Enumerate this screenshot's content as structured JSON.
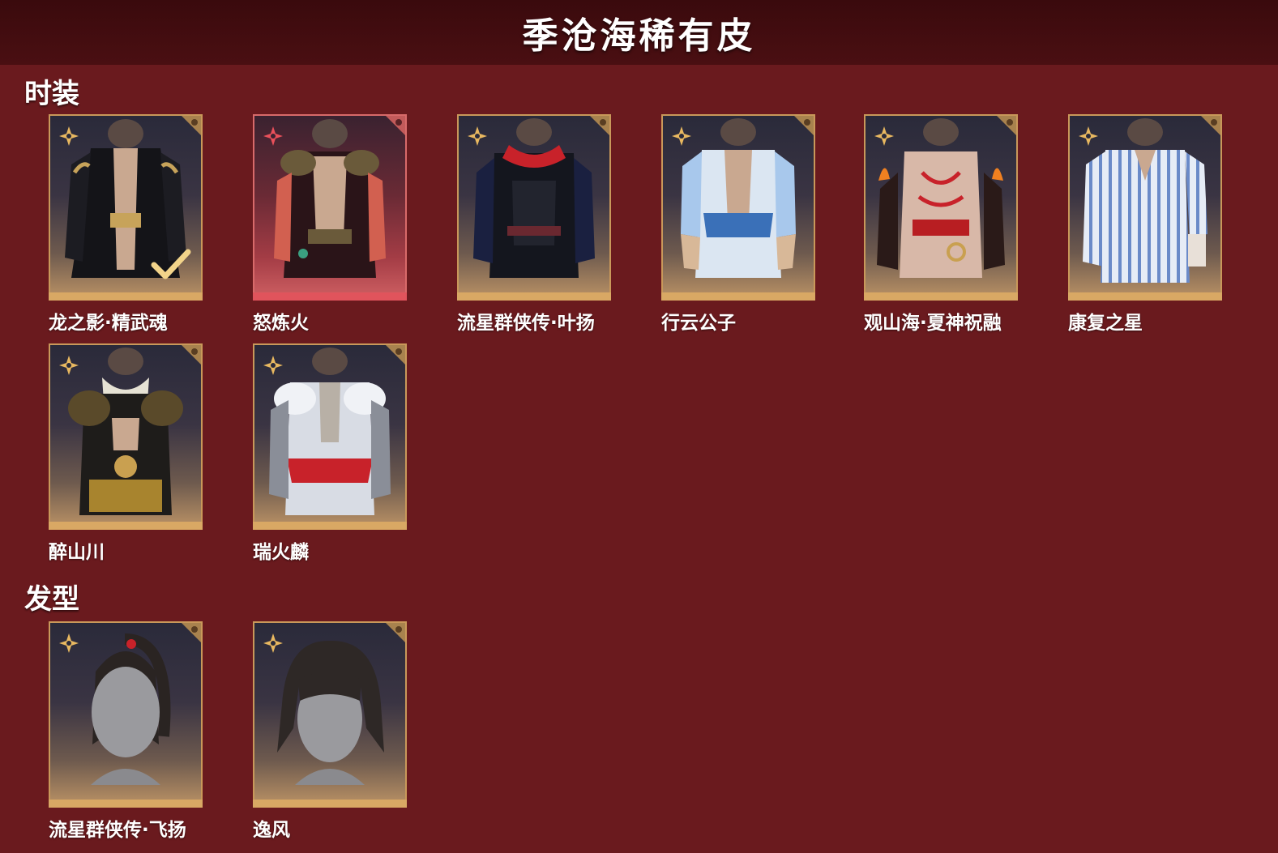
{
  "header": {
    "title": "季沧海稀有皮"
  },
  "sections": {
    "outfits": {
      "title": "时装",
      "items": [
        {
          "name": "龙之影·精武魂",
          "icon": "outfit-black-robe-icon",
          "tier": "gold",
          "selected": true
        },
        {
          "name": "怒炼火",
          "icon": "outfit-fire-armor-icon",
          "tier": "red",
          "selected": false
        },
        {
          "name": "流星群侠传·叶扬",
          "icon": "outfit-dark-scarf-icon",
          "tier": "gold",
          "selected": false
        },
        {
          "name": "行云公子",
          "icon": "outfit-blue-silk-icon",
          "tier": "gold",
          "selected": false
        },
        {
          "name": "观山海·夏神祝融",
          "icon": "outfit-tattoo-flame-icon",
          "tier": "gold",
          "selected": false
        },
        {
          "name": "康复之星",
          "icon": "outfit-striped-pajama-icon",
          "tier": "gold",
          "selected": false
        },
        {
          "name": "醉山川",
          "icon": "outfit-gold-armor-icon",
          "tier": "gold",
          "selected": false
        },
        {
          "name": "瑞火麟",
          "icon": "outfit-silver-armor-icon",
          "tier": "gold",
          "selected": false
        }
      ]
    },
    "hairstyles": {
      "title": "发型",
      "items": [
        {
          "name": "流星群侠传·飞扬",
          "icon": "hair-ponytail-icon",
          "tier": "gold"
        },
        {
          "name": "逸风",
          "icon": "hair-shaggy-icon",
          "tier": "gold"
        }
      ]
    }
  },
  "colors": {
    "background": "#6a1a1e",
    "header": "#3a0a0d",
    "gold_accent": "#d9a864",
    "red_accent": "#e0545c"
  }
}
